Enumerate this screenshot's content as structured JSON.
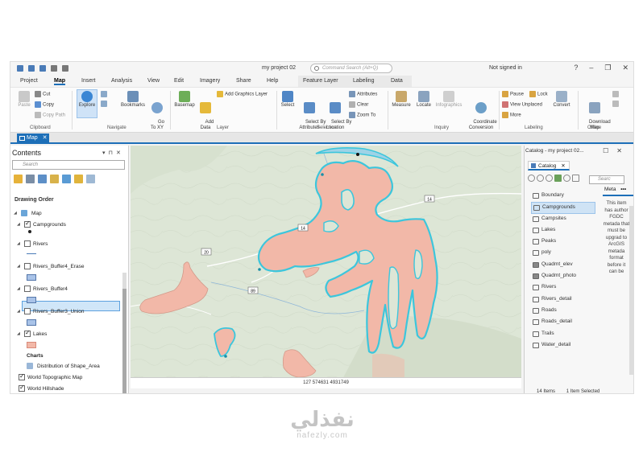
{
  "window": {
    "title": "my project 02",
    "command_search_placeholder": "Command Search (Alt+Q)",
    "signed_in": "Not signed in"
  },
  "ribbon_tabs": [
    "Project",
    "Map",
    "Insert",
    "Analysis",
    "View",
    "Edit",
    "Imagery",
    "Share",
    "Help",
    "Feature Layer",
    "Labeling",
    "Data"
  ],
  "active_tab": "Map",
  "ribbon": {
    "clipboard": {
      "paste": "Paste",
      "cut": "Cut",
      "copy": "Copy",
      "copy_path": "Copy Path",
      "group": "Clipboard"
    },
    "navigate": {
      "explore": "Explore",
      "bookmarks": "Bookmarks",
      "goto": "Go\nTo XY",
      "group": "Navigate"
    },
    "layer": {
      "basemap": "Basemap",
      "add_data": "Add\nData",
      "add_graphics": "Add Graphics Layer",
      "group": "Layer"
    },
    "selection": {
      "select": "Select",
      "select_by_attributes": "Select By\nAttributes",
      "select_by_location": "Select By\nLocation",
      "attributes": "Attributes",
      "clear": "Clear",
      "zoom_to": "Zoom To",
      "group": "Selection"
    },
    "inquiry": {
      "measure": "Measure",
      "locate": "Locate",
      "infographics": "Infographics",
      "coordinate_conversion": "Coordinate\nConversion",
      "group": "Inquiry"
    },
    "labeling": {
      "pause": "Pause",
      "lock": "Lock",
      "view_unplaced": "View Unplaced",
      "more": "More",
      "convert": "Convert",
      "group": "Labeling"
    },
    "offline": {
      "download_map": "Download\nMap",
      "group": "Offline"
    }
  },
  "view_tab": "Map",
  "contents": {
    "title": "Contents",
    "search_placeholder": "Search",
    "section": "Drawing Order",
    "layers": [
      {
        "name": "Map",
        "checked": true
      },
      {
        "name": "Campgrounds",
        "checked": true,
        "selected": true
      },
      {
        "name": "Rivers",
        "checked": false
      },
      {
        "name": "Rivers_Buffer4_Erase",
        "checked": false
      },
      {
        "name": "Rivers_Buffer4",
        "checked": false
      },
      {
        "name": "Rivers_Buffer3_Union",
        "checked": false
      },
      {
        "name": "Lakes",
        "checked": true
      },
      {
        "name": "Charts",
        "checked": false
      },
      {
        "name": "Distribution of Shape_Area",
        "checked": false
      },
      {
        "name": "World Topographic Map",
        "checked": true
      },
      {
        "name": "World Hillshade",
        "checked": true
      }
    ]
  },
  "map": {
    "road_labels": [
      "14",
      "14",
      "20",
      "89"
    ],
    "coordinates": "127 574631 4931749",
    "colors": {
      "terrain": "#dde6d6",
      "lake_fill": "#f2b8a8",
      "lake_outline": "#3cc6dc"
    }
  },
  "catalog": {
    "title": "Catalog - my project 02...",
    "tab": "Catalog",
    "search_placeholder": "Searc",
    "items": [
      "Boundary",
      "Campgrounds",
      "Campsites",
      "Lakes",
      "Peaks",
      "poly",
      "Quadmt_elev",
      "Quadmt_photo",
      "Rivers",
      "Rivers_detail",
      "Roads",
      "Roads_detail",
      "Trails",
      "Water_detail"
    ],
    "selected_item": "Campgrounds",
    "metadata_tab": "Meta",
    "metadata_text": "This item has author FGDC metada that must be upgrad to ArcGIS metada format before it can be",
    "status_items": "14 Items",
    "status_selected": "1 Item Selected"
  },
  "watermark": {
    "arabic": "نفذلي",
    "latin": "nafezly.com"
  }
}
